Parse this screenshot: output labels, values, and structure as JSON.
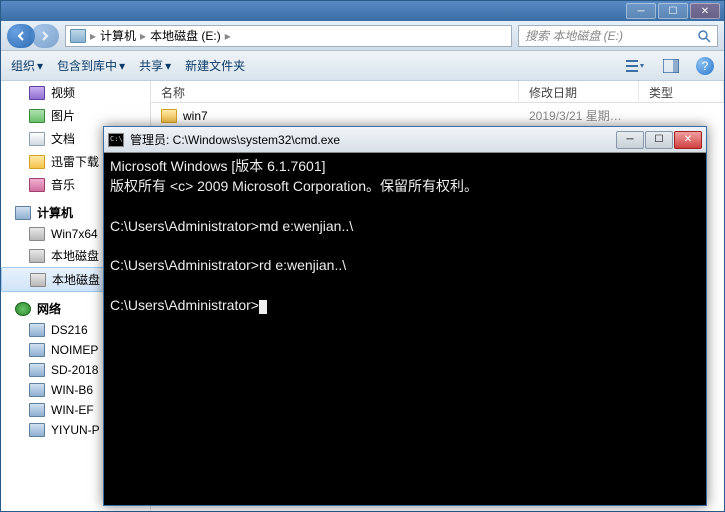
{
  "explorer": {
    "breadcrumb": {
      "root": "计算机",
      "drive": "本地磁盘 (E:)"
    },
    "search_placeholder": "搜索 本地磁盘 (E:)",
    "toolbar": {
      "organize": "组织",
      "include": "包含到库中",
      "share": "共享",
      "new_folder": "新建文件夹"
    },
    "columns": {
      "name": "名称",
      "date": "修改日期",
      "type": "类型"
    },
    "sidebar": {
      "libraries": [
        {
          "label": "视频",
          "icon": "ic-video"
        },
        {
          "label": "图片",
          "icon": "ic-pic"
        },
        {
          "label": "文档",
          "icon": "ic-doc"
        },
        {
          "label": "迅雷下载",
          "icon": "ic-folder"
        },
        {
          "label": "音乐",
          "icon": "ic-music"
        }
      ],
      "computer_header": "计算机",
      "computer": [
        {
          "label": "Win7x64",
          "icon": "ic-drive"
        },
        {
          "label": "本地磁盘",
          "icon": "ic-drive"
        },
        {
          "label": "本地磁盘",
          "icon": "ic-drive",
          "selected": true
        }
      ],
      "network_header": "网络",
      "network": [
        {
          "label": "DS216",
          "icon": "ic-computer"
        },
        {
          "label": "NOIMEP",
          "icon": "ic-computer"
        },
        {
          "label": "SD-2018",
          "icon": "ic-computer"
        },
        {
          "label": "WIN-B6",
          "icon": "ic-computer"
        },
        {
          "label": "WIN-EF",
          "icon": "ic-computer"
        },
        {
          "label": "YIYUN-P",
          "icon": "ic-computer"
        }
      ]
    },
    "files": [
      {
        "name": "win7",
        "date": "2019/3/21 星期…"
      }
    ]
  },
  "cmd": {
    "title": "管理员: C:\\Windows\\system32\\cmd.exe",
    "lines": "Microsoft Windows [版本 6.1.7601]\n版权所有 <c> 2009 Microsoft Corporation。保留所有权利。\n\nC:\\Users\\Administrator>md e:wenjian..\\\n\nC:\\Users\\Administrator>rd e:wenjian..\\\n\nC:\\Users\\Administrator>"
  }
}
